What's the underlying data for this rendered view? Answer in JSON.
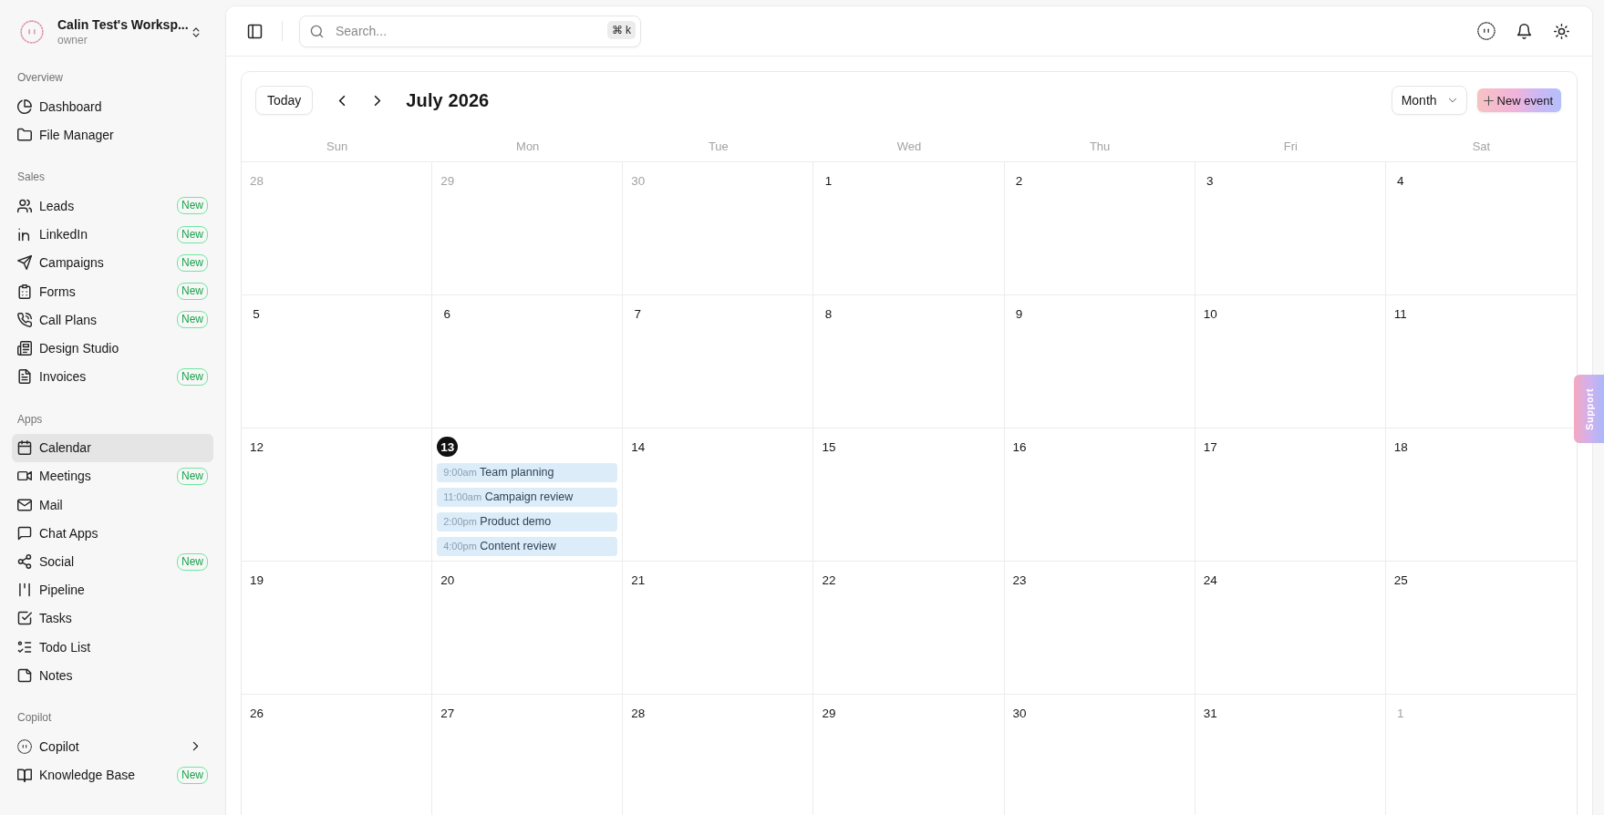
{
  "workspace": {
    "name": "Calin Test's Worksp...",
    "role": "owner"
  },
  "sidebar": {
    "sections": [
      {
        "title": "Overview",
        "items": [
          {
            "label": "Dashboard",
            "selected": false,
            "submenu": false
          },
          {
            "label": "File Manager",
            "selected": false,
            "submenu": false
          }
        ]
      },
      {
        "title": "Sales",
        "items": [
          {
            "label": "Leads",
            "badge": "New",
            "selected": false,
            "submenu": false
          },
          {
            "label": "LinkedIn",
            "badge": "New",
            "selected": false,
            "submenu": false
          },
          {
            "label": "Campaigns",
            "badge": "New",
            "selected": false,
            "submenu": false
          },
          {
            "label": "Forms",
            "badge": "New",
            "selected": false,
            "submenu": false
          },
          {
            "label": "Call Plans",
            "badge": "New",
            "selected": false,
            "submenu": false
          },
          {
            "label": "Design Studio",
            "selected": false,
            "submenu": false
          },
          {
            "label": "Invoices",
            "badge": "New",
            "selected": false,
            "submenu": false
          }
        ]
      },
      {
        "title": "Apps",
        "items": [
          {
            "label": "Calendar",
            "selected": true,
            "submenu": false
          },
          {
            "label": "Meetings",
            "badge": "New",
            "selected": false,
            "submenu": false
          },
          {
            "label": "Mail",
            "selected": false,
            "submenu": false
          },
          {
            "label": "Chat Apps",
            "selected": false,
            "submenu": false
          },
          {
            "label": "Social",
            "badge": "New",
            "selected": false,
            "submenu": false
          },
          {
            "label": "Pipeline",
            "selected": false,
            "submenu": false
          },
          {
            "label": "Tasks",
            "selected": false,
            "submenu": false
          },
          {
            "label": "Todo List",
            "selected": false,
            "submenu": false
          },
          {
            "label": "Notes",
            "selected": false,
            "submenu": false
          }
        ]
      },
      {
        "title": "Copilot",
        "items": [
          {
            "label": "Copilot",
            "selected": false,
            "submenu": true
          },
          {
            "label": "Knowledge Base",
            "badge": "New",
            "selected": false,
            "submenu": false
          }
        ]
      }
    ]
  },
  "topbar": {
    "search": {
      "placeholder": "Search...",
      "shortcut": "⌘ k"
    }
  },
  "calendar": {
    "today_button": "Today",
    "title": "July 2026",
    "view": "Month",
    "new_event": "New event",
    "weekdays": [
      "Sun",
      "Mon",
      "Tue",
      "Wed",
      "Thu",
      "Fri",
      "Sat"
    ],
    "weeks": [
      {
        "days": [
          {
            "day": "28",
            "outside": true,
            "today": false
          },
          {
            "day": "29",
            "outside": true,
            "today": false
          },
          {
            "day": "30",
            "outside": true,
            "today": false
          },
          {
            "day": "1",
            "outside": false,
            "today": false
          },
          {
            "day": "2",
            "outside": false,
            "today": false
          },
          {
            "day": "3",
            "outside": false,
            "today": false
          },
          {
            "day": "4",
            "outside": false,
            "today": false
          }
        ]
      },
      {
        "days": [
          {
            "day": "5",
            "outside": false,
            "today": false
          },
          {
            "day": "6",
            "outside": false,
            "today": false
          },
          {
            "day": "7",
            "outside": false,
            "today": false
          },
          {
            "day": "8",
            "outside": false,
            "today": false
          },
          {
            "day": "9",
            "outside": false,
            "today": false
          },
          {
            "day": "10",
            "outside": false,
            "today": false
          },
          {
            "day": "11",
            "outside": false,
            "today": false
          }
        ]
      },
      {
        "days": [
          {
            "day": "12",
            "outside": false,
            "today": false
          },
          {
            "day": "13",
            "outside": false,
            "today": true,
            "events": [
              {
                "time": "9:00am",
                "title": "Team planning"
              },
              {
                "time": "11:00am",
                "title": "Campaign review"
              },
              {
                "time": "2:00pm",
                "title": "Product demo"
              },
              {
                "time": "4:00pm",
                "title": "Content review"
              }
            ]
          },
          {
            "day": "14",
            "outside": false,
            "today": false
          },
          {
            "day": "15",
            "outside": false,
            "today": false
          },
          {
            "day": "16",
            "outside": false,
            "today": false
          },
          {
            "day": "17",
            "outside": false,
            "today": false
          },
          {
            "day": "18",
            "outside": false,
            "today": false
          }
        ]
      },
      {
        "days": [
          {
            "day": "19",
            "outside": false,
            "today": false
          },
          {
            "day": "20",
            "outside": false,
            "today": false
          },
          {
            "day": "21",
            "outside": false,
            "today": false
          },
          {
            "day": "22",
            "outside": false,
            "today": false
          },
          {
            "day": "23",
            "outside": false,
            "today": false
          },
          {
            "day": "24",
            "outside": false,
            "today": false
          },
          {
            "day": "25",
            "outside": false,
            "today": false
          }
        ]
      },
      {
        "days": [
          {
            "day": "26",
            "outside": false,
            "today": false
          },
          {
            "day": "27",
            "outside": false,
            "today": false
          },
          {
            "day": "28",
            "outside": false,
            "today": false
          },
          {
            "day": "29",
            "outside": false,
            "today": false
          },
          {
            "day": "30",
            "outside": false,
            "today": false
          },
          {
            "day": "31",
            "outside": false,
            "today": false
          },
          {
            "day": "1",
            "outside": true,
            "today": false
          }
        ]
      }
    ]
  },
  "support_tab": "Support"
}
